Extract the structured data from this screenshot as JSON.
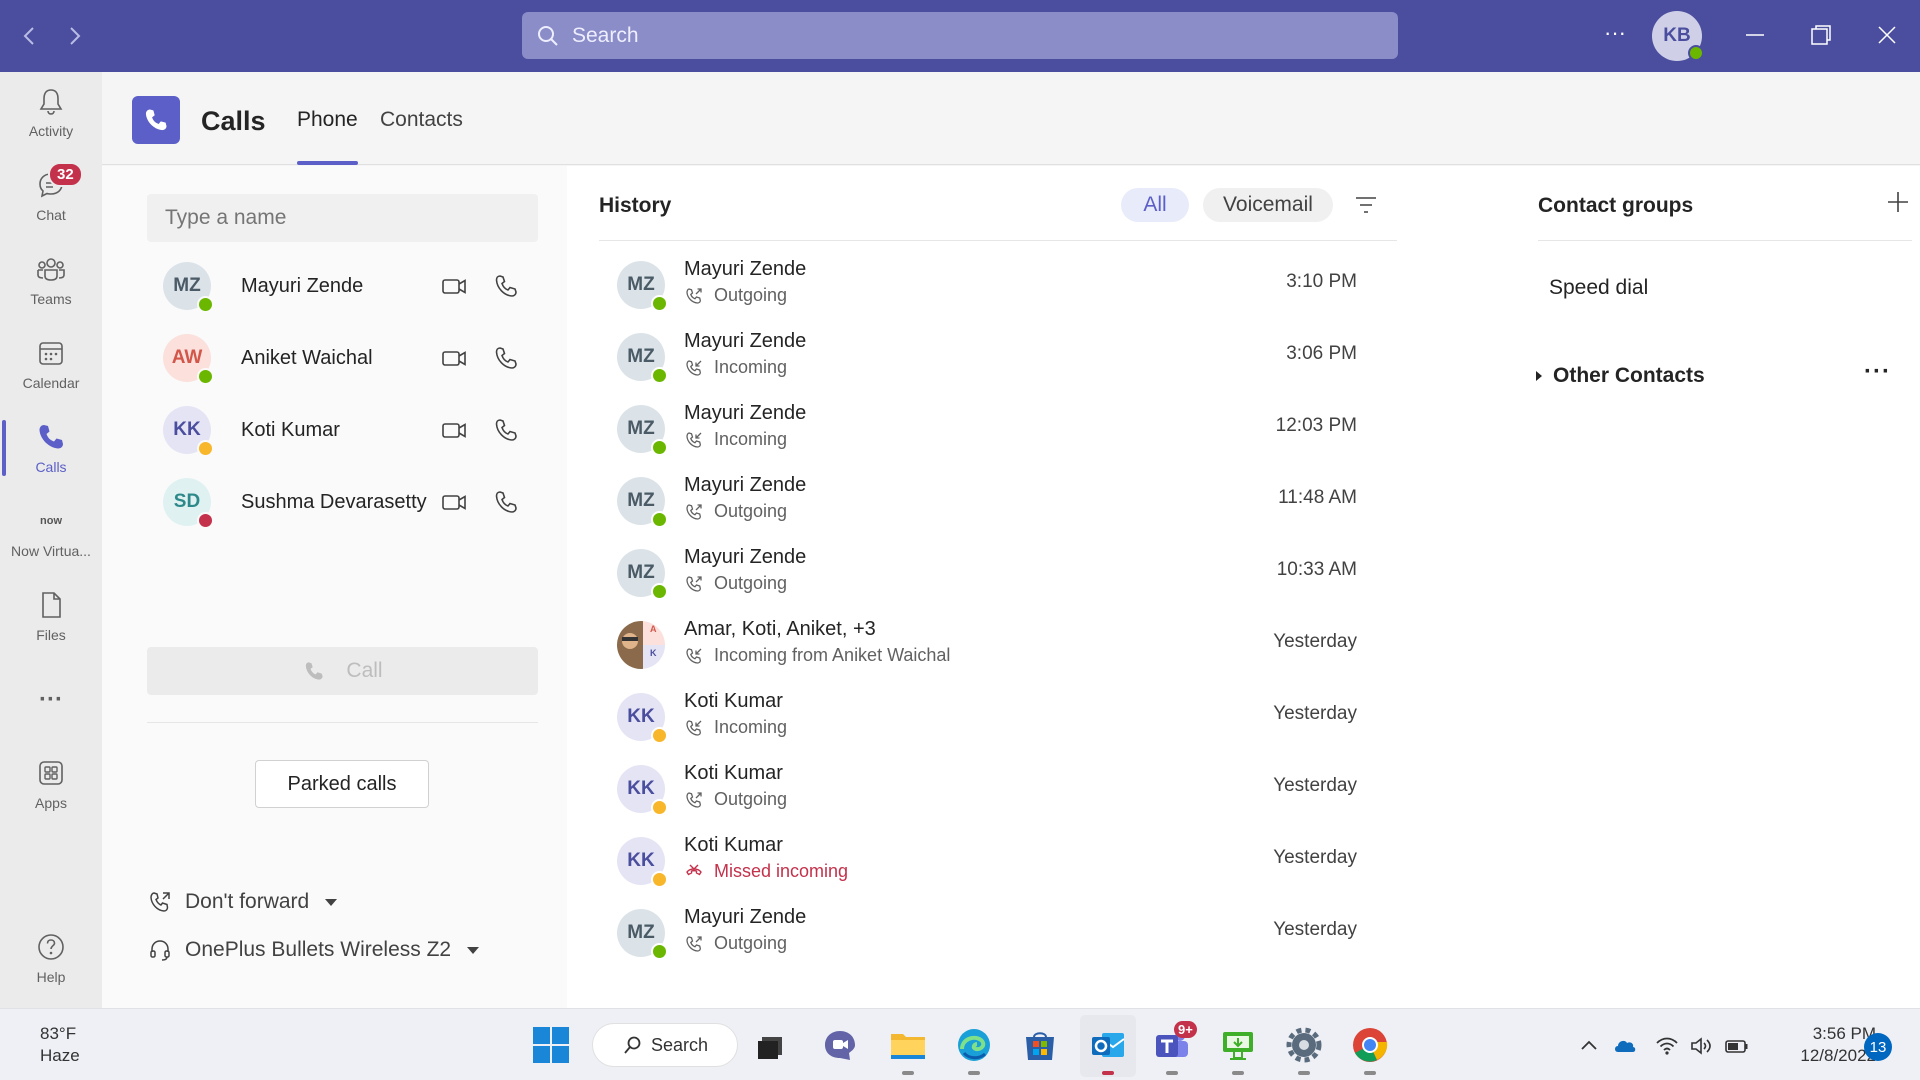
{
  "titlebar": {
    "search_placeholder": "Search",
    "more_label": "···",
    "user_initials": "KB"
  },
  "rail": {
    "items": [
      {
        "label": "Activity",
        "icon": "bell-icon"
      },
      {
        "label": "Chat",
        "icon": "chat-icon",
        "badge": "32"
      },
      {
        "label": "Teams",
        "icon": "teams-icon"
      },
      {
        "label": "Calendar",
        "icon": "calendar-icon"
      },
      {
        "label": "Calls",
        "icon": "phone-icon",
        "active": true
      },
      {
        "label": "Now Virtua...",
        "icon": "now-logo",
        "logo_text": "now"
      },
      {
        "label": "Files",
        "icon": "file-icon"
      },
      {
        "label": "···",
        "icon": "more-icon"
      },
      {
        "label": "Apps",
        "icon": "apps-icon"
      },
      {
        "label": "Help",
        "icon": "help-icon"
      }
    ]
  },
  "header": {
    "title": "Calls",
    "tabs": [
      {
        "label": "Phone",
        "active": true
      },
      {
        "label": "Contacts",
        "active": false
      }
    ]
  },
  "dialer": {
    "input_placeholder": "Type a name",
    "contacts": [
      {
        "initials": "MZ",
        "name": "Mayuri Zende",
        "status": "available",
        "bg": "#dbe3e8",
        "fg": "#4a5a66"
      },
      {
        "initials": "AW",
        "name": "Aniket Waichal",
        "status": "available",
        "bg": "#fbe0dc",
        "fg": "#d2564a"
      },
      {
        "initials": "KK",
        "name": "Koti Kumar",
        "status": "away",
        "bg": "#e4e4f4",
        "fg": "#4b4e9e"
      },
      {
        "initials": "SD",
        "name": "Sushma Devarasetty",
        "status": "busy",
        "bg": "#dff1f1",
        "fg": "#2e8a8a"
      }
    ],
    "call_label": "Call",
    "parked_label": "Parked calls",
    "forward_label": "Don't forward",
    "device_label": "OnePlus Bullets Wireless Z2"
  },
  "history": {
    "title": "History",
    "filters": [
      {
        "label": "All",
        "active": true
      },
      {
        "label": "Voicemail",
        "active": false
      }
    ],
    "rows": [
      {
        "initials": "MZ",
        "name": "Mayuri Zende",
        "type": "Outgoing",
        "time": "3:10 PM",
        "status": "available",
        "kind": "outgoing"
      },
      {
        "initials": "MZ",
        "name": "Mayuri Zende",
        "type": "Incoming",
        "time": "3:06 PM",
        "status": "available",
        "kind": "incoming"
      },
      {
        "initials": "MZ",
        "name": "Mayuri Zende",
        "type": "Incoming",
        "time": "12:03 PM",
        "status": "available",
        "kind": "incoming"
      },
      {
        "initials": "MZ",
        "name": "Mayuri Zende",
        "type": "Outgoing",
        "time": "11:48 AM",
        "status": "available",
        "kind": "outgoing"
      },
      {
        "initials": "MZ",
        "name": "Mayuri Zende",
        "type": "Outgoing",
        "time": "10:33 AM",
        "status": "available",
        "kind": "outgoing"
      },
      {
        "initials": "",
        "name": "Amar, Koti, Aniket, +3",
        "type": "Incoming from Aniket Waichal",
        "time": "Yesterday",
        "status": "group",
        "kind": "incoming",
        "group_letters": [
          "A",
          "K"
        ]
      },
      {
        "initials": "KK",
        "name": "Koti Kumar",
        "type": "Incoming",
        "time": "Yesterday",
        "status": "away",
        "kind": "incoming"
      },
      {
        "initials": "KK",
        "name": "Koti Kumar",
        "type": "Outgoing",
        "time": "Yesterday",
        "status": "away",
        "kind": "outgoing"
      },
      {
        "initials": "KK",
        "name": "Koti Kumar",
        "type": "Missed incoming",
        "time": "Yesterday",
        "status": "away",
        "kind": "missed"
      },
      {
        "initials": "MZ",
        "name": "Mayuri Zende",
        "type": "Outgoing",
        "time": "Yesterday",
        "status": "available",
        "kind": "outgoing"
      }
    ]
  },
  "groups": {
    "title": "Contact groups",
    "speed_dial": "Speed dial",
    "other_contacts": "Other Contacts",
    "more_label": "···"
  },
  "taskbar": {
    "temp": "83°F",
    "condition": "Haze",
    "search_label": "Search",
    "teams_badge": "9+",
    "time": "3:56 PM",
    "date": "12/8/2022",
    "notifications": "13"
  },
  "colors": {
    "accent": "#5b5fc7",
    "titlebar": "#4b4e9e",
    "available": "#6bb700",
    "away": "#f8b62a",
    "busy": "#c4314b",
    "missed": "#c4314b"
  }
}
